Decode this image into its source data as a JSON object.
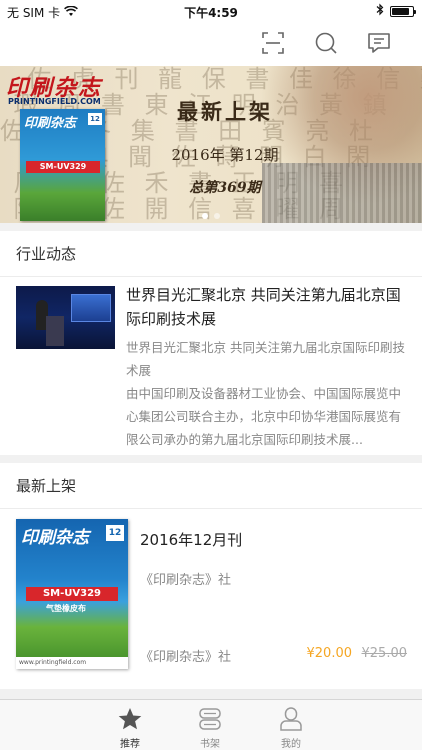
{
  "status_bar": {
    "carrier": "无 SIM 卡",
    "time": "下午4:59",
    "battery_level": 0.85
  },
  "nav": {
    "icons": [
      "scan-icon",
      "search-icon",
      "message-icon"
    ]
  },
  "banner": {
    "logo_text": "印刷杂志",
    "logo_sub": "PRINTINGFIELD.COM",
    "magazine_title": "印刷杂志",
    "magazine_badge": "SM-UV329",
    "magazine_issue_badge": "12",
    "headline": "最新上架",
    "issue": "2016年 第12期",
    "total": "总第369期",
    "page_count": 2,
    "active_page": 0
  },
  "news_section": {
    "title": "行业动态",
    "item": {
      "title": "世界目光汇聚北京 共同关注第九届北京国际印刷技术展",
      "description": "世界目光汇聚北京 共同关注第九届北京国际印刷技术展\n由中国印刷及设备器材工业协会、中国国际展览中心集团公司联合主办，北京中印协华港国际展览有限公司承办的第九届北京国际印刷技术展..."
    }
  },
  "latest_section": {
    "title": "最新上架",
    "item": {
      "cover_title": "印刷杂志",
      "cover_issue_badge": "12",
      "cover_badge": "SM-UV329",
      "cover_sub": "气垫橡皮布",
      "cover_foot": "www.printingfield.com",
      "title": "2016年12月刊",
      "publisher": "《印刷杂志》社",
      "publisher_bottom": "《印刷杂志》社",
      "price": "¥20.00",
      "old_price": "¥25.00"
    }
  },
  "tabs": [
    {
      "label": "推荐",
      "icon": "star-icon",
      "active": true
    },
    {
      "label": "书架",
      "icon": "bookshelf-icon",
      "active": false
    },
    {
      "label": "我的",
      "icon": "user-icon",
      "active": false
    }
  ],
  "colors": {
    "price": "#f5a623",
    "accent_red": "#c4161c",
    "background": "#f1f1f1"
  }
}
